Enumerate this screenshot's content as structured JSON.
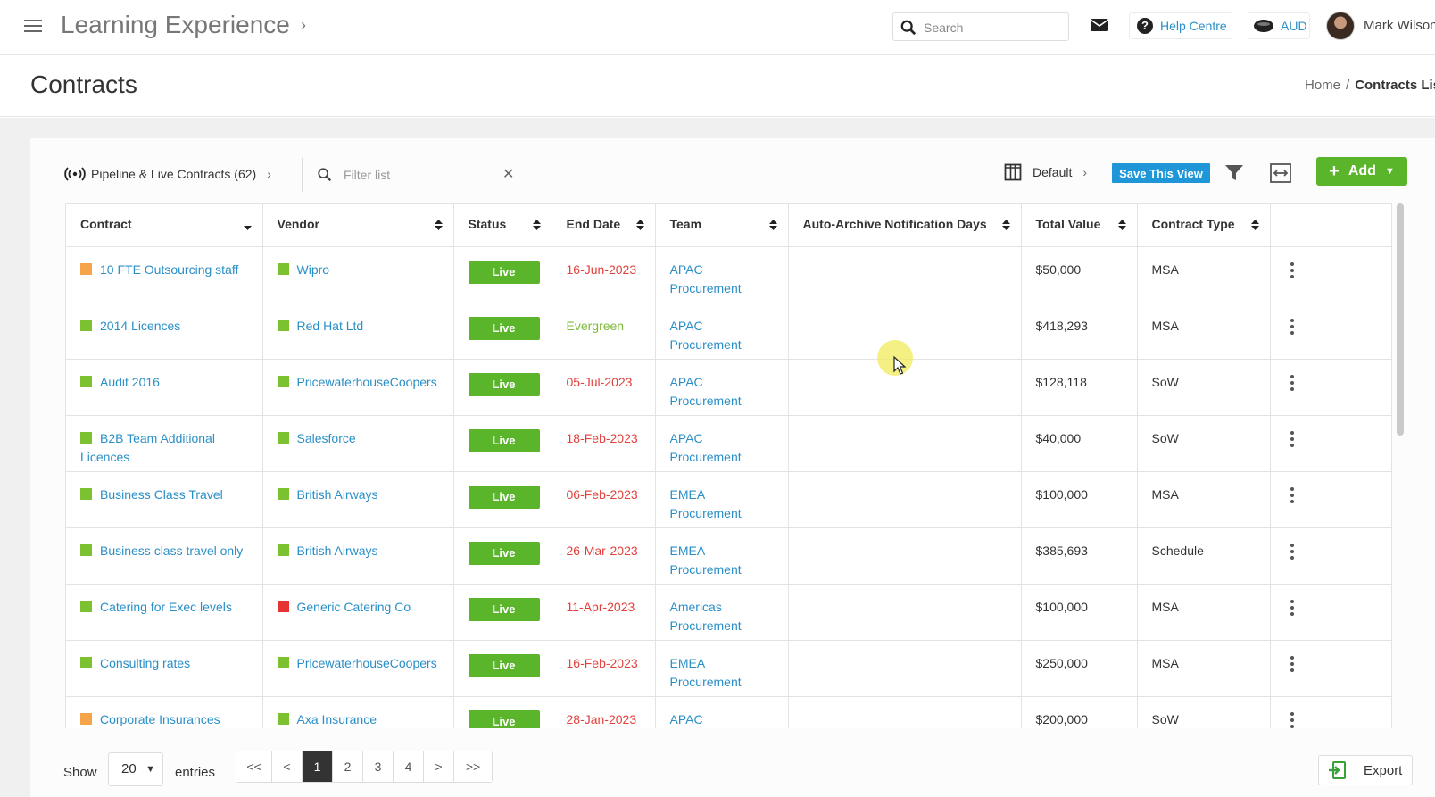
{
  "topbar": {
    "app_title": "Learning Experience",
    "search_placeholder": "Search",
    "help_label": "Help Centre",
    "currency_label": "AUD",
    "user_name": "Mark Wilson"
  },
  "page": {
    "title": "Contracts",
    "breadcrumb": {
      "home": "Home",
      "separator": "/",
      "current": "Contracts List"
    }
  },
  "toolbar": {
    "pipeline_label": "Pipeline & Live Contracts (62)",
    "filter_placeholder": "Filter list",
    "view_label": "Default",
    "save_view_label": "Save This View",
    "add_label": "Add"
  },
  "table": {
    "columns": [
      "Contract",
      "Vendor",
      "Status",
      "End Date",
      "Team",
      "Auto-Archive Notification Days",
      "Total Value",
      "Contract Type"
    ],
    "rows": [
      {
        "contract": "10 FTE Outsourcing staff",
        "contract_color": "#f6a44a",
        "vendor": "Wipro",
        "vendor_color": "#7cc130",
        "status": "Live",
        "end_date": "16-Jun-2023",
        "end_date_state": "overdue",
        "team": "APAC Procurement",
        "auto_archive": "",
        "total_value": "$50,000",
        "contract_type": "MSA"
      },
      {
        "contract": "2014 Licences",
        "contract_color": "#7cc130",
        "vendor": "Red Hat Ltd",
        "vendor_color": "#7cc130",
        "status": "Live",
        "end_date": "Evergreen",
        "end_date_state": "evergreen",
        "team": "APAC Procurement",
        "auto_archive": "",
        "total_value": "$418,293",
        "contract_type": "MSA"
      },
      {
        "contract": "Audit 2016",
        "contract_color": "#7cc130",
        "vendor": "PricewaterhouseCoopers",
        "vendor_color": "#7cc130",
        "status": "Live",
        "end_date": "05-Jul-2023",
        "end_date_state": "overdue",
        "team": "APAC Procurement",
        "auto_archive": "",
        "total_value": "$128,118",
        "contract_type": "SoW"
      },
      {
        "contract": "B2B Team Additional Licences",
        "contract_color": "#7cc130",
        "vendor": "Salesforce",
        "vendor_color": "#7cc130",
        "status": "Live",
        "end_date": "18-Feb-2023",
        "end_date_state": "overdue",
        "team": "APAC Procurement",
        "auto_archive": "",
        "total_value": "$40,000",
        "contract_type": "SoW"
      },
      {
        "contract": "Business Class Travel",
        "contract_color": "#7cc130",
        "vendor": "British Airways",
        "vendor_color": "#7cc130",
        "status": "Live",
        "end_date": "06-Feb-2023",
        "end_date_state": "overdue",
        "team": "EMEA Procurement",
        "auto_archive": "",
        "total_value": "$100,000",
        "contract_type": "MSA"
      },
      {
        "contract": "Business class travel only",
        "contract_color": "#7cc130",
        "vendor": "British Airways",
        "vendor_color": "#7cc130",
        "status": "Live",
        "end_date": "26-Mar-2023",
        "end_date_state": "overdue",
        "team": "EMEA Procurement",
        "auto_archive": "",
        "total_value": "$385,693",
        "contract_type": "Schedule"
      },
      {
        "contract": "Catering for Exec levels",
        "contract_color": "#7cc130",
        "vendor": "Generic Catering Co",
        "vendor_color": "#e53232",
        "status": "Live",
        "end_date": "11-Apr-2023",
        "end_date_state": "overdue",
        "team": "Americas Procurement",
        "auto_archive": "",
        "total_value": "$100,000",
        "contract_type": "MSA"
      },
      {
        "contract": "Consulting rates",
        "contract_color": "#7cc130",
        "vendor": "PricewaterhouseCoopers",
        "vendor_color": "#7cc130",
        "status": "Live",
        "end_date": "16-Feb-2023",
        "end_date_state": "overdue",
        "team": "EMEA Procurement",
        "auto_archive": "",
        "total_value": "$250,000",
        "contract_type": "MSA"
      },
      {
        "contract": "Corporate Insurances",
        "contract_color": "#f6a44a",
        "vendor": "Axa Insurance",
        "vendor_color": "#7cc130",
        "status": "Live",
        "end_date": "28-Jan-2023",
        "end_date_state": "overdue",
        "team": "APAC Procurement",
        "auto_archive": "",
        "total_value": "$200,000",
        "contract_type": "SoW"
      }
    ]
  },
  "footer": {
    "show_label": "Show",
    "page_size": "20",
    "entries_label": "entries",
    "pages": [
      "<<",
      "<",
      "1",
      "2",
      "3",
      "4",
      ">",
      ">>"
    ],
    "current_page": "1",
    "export_label": "Export"
  },
  "colors": {
    "accent": "#2a8fc7",
    "add_green": "#5ab52b",
    "save_blue": "#1e96d8",
    "overdue": "#e2403b",
    "evergreen": "#7fba3a"
  }
}
